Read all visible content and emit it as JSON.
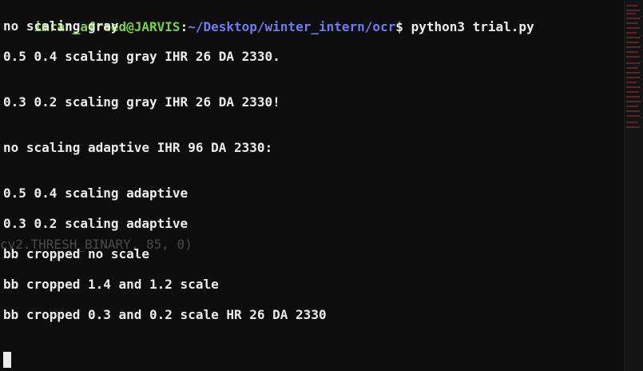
{
  "prompt": {
    "user_host": "imran_afreed@JARVIS",
    "colon": ":",
    "path": "~/Desktop/winter_intern/ocr",
    "dollar": "$",
    "command": " python3 trial.py"
  },
  "output": [
    "no scaling gray",
    "0.5 0.4 scaling gray IHR 26 DA 2330.",
    "0.3 0.2 scaling gray IHR 26 DA 2330!",
    "no scaling adaptive IHR 96 DA 2330:",
    "0.5 0.4 scaling adaptive",
    "0.3 0.2 scaling adaptive",
    "bb cropped no scale",
    "bb cropped 1.4 and 1.2 scale",
    "bb cropped 0.3 and 0.2 scale HR 26 DA 2330"
  ],
  "ghost_text": "cv2.THRESH_BINARY, 85, 0)",
  "colors": {
    "background": "#0d0d0d",
    "text": "#ececec",
    "user_host": "#7dd33a",
    "path": "#6f7cf0",
    "ghost": "#4a4a4a"
  }
}
